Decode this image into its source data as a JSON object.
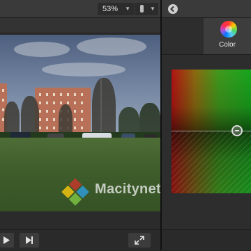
{
  "viewer": {
    "zoom_value": "53%",
    "watermark_text": "Macitynet.it"
  },
  "inspector": {
    "color_tab_label": "Color"
  },
  "icons": {
    "zoom_dropdown": "chevron-down-icon",
    "view_options": "view-options-icon",
    "back": "back-arrow-icon",
    "color_tab": "color-wheel-icon",
    "play": "play-icon",
    "next": "skip-to-end-icon",
    "fullscreen": "fullscreen-icon",
    "color_puck": "color-puck-icon"
  },
  "colors": {
    "panel_bg": "#2d2d2d",
    "toolbar_bg": "#3a3a3a",
    "divider": "#111111",
    "board_red": "#b21313",
    "board_green": "#17a51d"
  }
}
